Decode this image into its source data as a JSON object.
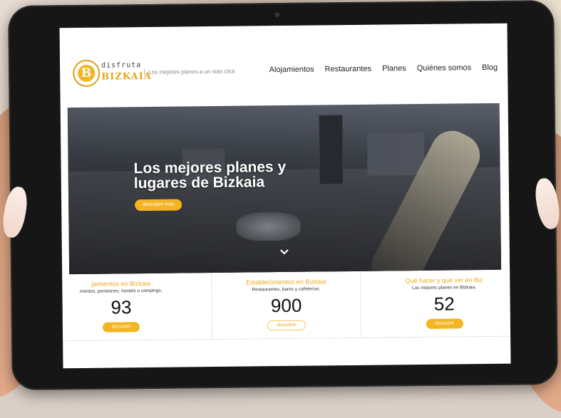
{
  "brand": {
    "logo_letter": "B",
    "top": "disfruta",
    "bottom": "BIZKAIA",
    "tagline": "Los mejores planes a un solo click"
  },
  "nav": [
    "Alojamientos",
    "Restaurantes",
    "Planes",
    "Quiénes somos",
    "Blog"
  ],
  "hero": {
    "title": "Los mejores planes y lugares de Bizkaia",
    "button": "descubrir más"
  },
  "stats": [
    {
      "title": "jamientos en Bizkaia",
      "subtitle": "mentos, pensiones, hostels o campings.",
      "number": "93",
      "button": "descubrir"
    },
    {
      "title": "Establecimientos en Bizkaia",
      "subtitle": "Restaurantes, bares y cafeterías.",
      "number": "900",
      "button": "descubrir"
    },
    {
      "title": "Qué hacer y qué ver en Biz",
      "subtitle": "Los mejores planes en Bizkaia.",
      "number": "52",
      "button": "descubrir"
    }
  ],
  "colors": {
    "accent": "#f4b522",
    "accent_text": "#f0a81c"
  }
}
